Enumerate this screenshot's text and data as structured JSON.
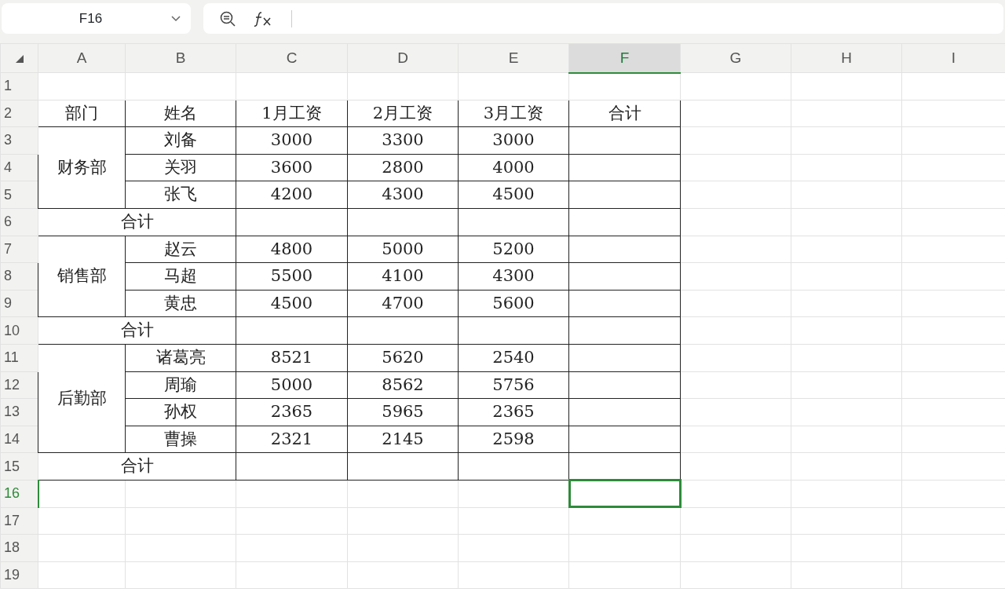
{
  "name_box": {
    "value": "F16"
  },
  "columns": [
    {
      "label": "A",
      "selected": false
    },
    {
      "label": "B",
      "selected": false
    },
    {
      "label": "C",
      "selected": false
    },
    {
      "label": "D",
      "selected": false
    },
    {
      "label": "E",
      "selected": false
    },
    {
      "label": "F",
      "selected": true
    },
    {
      "label": "G",
      "selected": false
    },
    {
      "label": "H",
      "selected": false
    },
    {
      "label": "I",
      "selected": false
    }
  ],
  "rows": [
    {
      "label": "1",
      "selected": false
    },
    {
      "label": "2",
      "selected": false
    },
    {
      "label": "3",
      "selected": false
    },
    {
      "label": "4",
      "selected": false
    },
    {
      "label": "5",
      "selected": false
    },
    {
      "label": "6",
      "selected": false
    },
    {
      "label": "7",
      "selected": false
    },
    {
      "label": "8",
      "selected": false
    },
    {
      "label": "9",
      "selected": false
    },
    {
      "label": "10",
      "selected": false
    },
    {
      "label": "11",
      "selected": false
    },
    {
      "label": "12",
      "selected": false
    },
    {
      "label": "13",
      "selected": false
    },
    {
      "label": "14",
      "selected": false
    },
    {
      "label": "15",
      "selected": false
    },
    {
      "label": "16",
      "selected": true
    },
    {
      "label": "17",
      "selected": false
    },
    {
      "label": "18",
      "selected": false
    },
    {
      "label": "19",
      "selected": false
    }
  ],
  "table": {
    "header": [
      "部门",
      "姓名",
      "1月工资",
      "2月工资",
      "3月工资",
      "合计"
    ],
    "groups": [
      {
        "department": "财务部",
        "subtotal_label": "合计",
        "people": [
          {
            "name": "刘备",
            "values": [
              "3000",
              "3300",
              "3000"
            ]
          },
          {
            "name": "关羽",
            "values": [
              "3600",
              "2800",
              "4000"
            ]
          },
          {
            "name": "张飞",
            "values": [
              "4200",
              "4300",
              "4500"
            ]
          }
        ]
      },
      {
        "department": "销售部",
        "subtotal_label": "合计",
        "people": [
          {
            "name": "赵云",
            "values": [
              "4800",
              "5000",
              "5200"
            ]
          },
          {
            "name": "马超",
            "values": [
              "5500",
              "4100",
              "4300"
            ]
          },
          {
            "name": "黄忠",
            "values": [
              "4500",
              "4700",
              "5600"
            ]
          }
        ]
      },
      {
        "department": "后勤部",
        "subtotal_label": "合计",
        "people": [
          {
            "name": "诸葛亮",
            "values": [
              "8521",
              "5620",
              "2540"
            ]
          },
          {
            "name": "周瑜",
            "values": [
              "5000",
              "8562",
              "5756"
            ]
          },
          {
            "name": "孙权",
            "values": [
              "2365",
              "5965",
              "2365"
            ]
          },
          {
            "name": "曹操",
            "values": [
              "2321",
              "2145",
              "2598"
            ]
          }
        ]
      }
    ]
  }
}
